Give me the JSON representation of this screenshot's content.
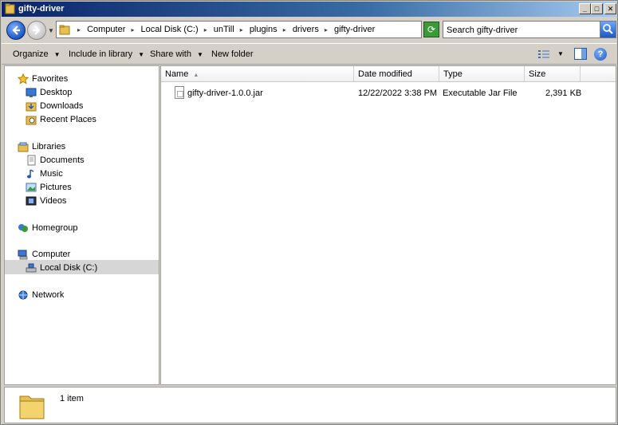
{
  "window": {
    "title": "gifty-driver"
  },
  "titlebar": {
    "minimize": "_",
    "maximize": "□",
    "close": "✕"
  },
  "address": {
    "breadcrumbs": [
      "Computer",
      "Local Disk (C:)",
      "unTill",
      "plugins",
      "drivers",
      "gifty-driver"
    ]
  },
  "search": {
    "placeholder": "Search gifty-driver"
  },
  "toolbar": {
    "organize": "Organize",
    "include_in_library": "Include in library",
    "share_with": "Share with",
    "new_folder": "New folder"
  },
  "navpane": {
    "favorites": {
      "label": "Favorites",
      "items": [
        "Desktop",
        "Downloads",
        "Recent Places"
      ]
    },
    "libraries": {
      "label": "Libraries",
      "items": [
        "Documents",
        "Music",
        "Pictures",
        "Videos"
      ]
    },
    "homegroup": "Homegroup",
    "computer": {
      "label": "Computer",
      "items": [
        "Local Disk (C:)"
      ]
    },
    "network": "Network",
    "selected": "Local Disk (C:)"
  },
  "columns": {
    "name": "Name",
    "date_modified": "Date modified",
    "type": "Type",
    "size": "Size"
  },
  "files": [
    {
      "name": "gifty-driver-1.0.0.jar",
      "date_modified": "12/22/2022 3:38 PM",
      "type": "Executable Jar File",
      "size": "2,391 KB"
    }
  ],
  "details": {
    "item_count": "1 item"
  },
  "icons": {
    "back": "back-arrow-icon",
    "forward": "forward-arrow-icon",
    "refresh": "refresh-icon",
    "search": "search-icon",
    "views": "views-icon",
    "preview_pane": "preview-pane-icon",
    "help": "help-icon"
  },
  "colors": {
    "titlebar": "#0a246a",
    "selection": "#d6d6d6",
    "chrome": "#d4d0c8"
  }
}
